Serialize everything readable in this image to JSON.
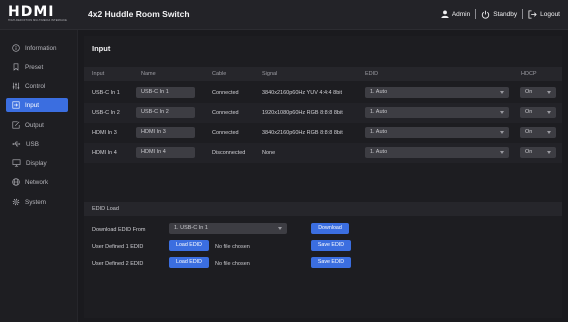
{
  "brand": {
    "logo_text": "HDMI",
    "logo_sub": "HIGH-DEFINITION MULTIMEDIA INTERFACE"
  },
  "header": {
    "title": "4x2 Huddle Room Switch",
    "user_label": "Admin",
    "standby_label": "Standby",
    "logout_label": "Logout"
  },
  "sidebar": {
    "items": [
      {
        "label": "Information",
        "icon": "info-icon"
      },
      {
        "label": "Preset",
        "icon": "preset-icon"
      },
      {
        "label": "Control",
        "icon": "sliders-icon"
      },
      {
        "label": "Input",
        "icon": "input-icon",
        "active": true
      },
      {
        "label": "Output",
        "icon": "output-icon"
      },
      {
        "label": "USB",
        "icon": "usb-icon"
      },
      {
        "label": "Display",
        "icon": "display-icon"
      },
      {
        "label": "Network",
        "icon": "globe-icon"
      },
      {
        "label": "System",
        "icon": "gear-icon"
      }
    ]
  },
  "input": {
    "title": "Input",
    "columns": [
      "Input",
      "Name",
      "Cable",
      "Signal",
      "EDID",
      "HDCP"
    ],
    "rows": [
      {
        "input": "USB-C In 1",
        "name": "USB-C In 1",
        "cable": "Connected",
        "signal": "3840x2160p60Hz YUV 4:4:4 8bit",
        "edid": "1. Auto",
        "hdcp": "On"
      },
      {
        "input": "USB-C In 2",
        "name": "USB-C In 2",
        "cable": "Connected",
        "signal": "1920x1080p60Hz RGB 8:8:8 8bit",
        "edid": "1. Auto",
        "hdcp": "On"
      },
      {
        "input": "HDMI In 3",
        "name": "HDMI In 3",
        "cable": "Connected",
        "signal": "3840x2160p60Hz RGB 8:8:8 8bit",
        "edid": "1. Auto",
        "hdcp": "On"
      },
      {
        "input": "HDMI In 4",
        "name": "HDMI In 4",
        "cable": "Disconnected",
        "signal": "None",
        "edid": "1. Auto",
        "hdcp": "On"
      }
    ]
  },
  "edid_load": {
    "title": "EDID Load",
    "download_label": "Download EDID From",
    "download_select": "1. USB-C In 1",
    "download_button": "Download",
    "user1_label": "User Defined 1 EDID",
    "user2_label": "User Defined 2 EDID",
    "load_button": "Load EDID",
    "no_file": "No file chosen",
    "save_button": "Save EDID"
  },
  "colors": {
    "accent": "#3b6ee0",
    "background": "#1a1a1e",
    "field": "#3d3d43"
  }
}
